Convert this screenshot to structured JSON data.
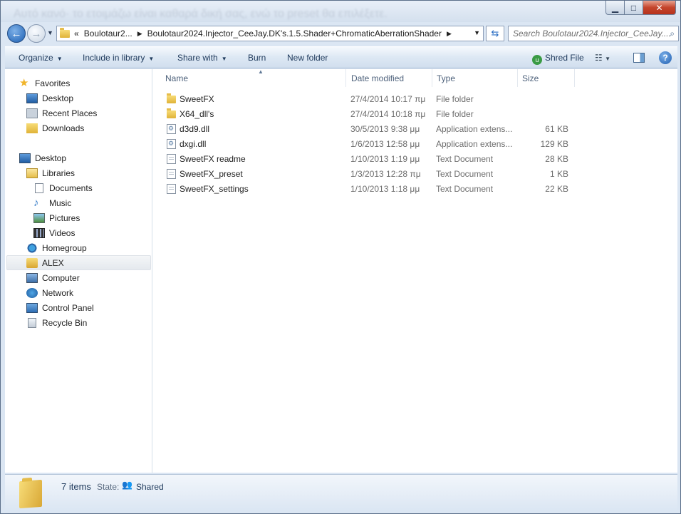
{
  "background_title": "Αυτό κανό· το ετοιμάζω είναι καθαρά δική σας, ενώ το preset θα επιλέξετε.",
  "address": {
    "overflow": "«",
    "crumbs": [
      "Boulotaur2...",
      "Boulotaur2024.Injector_CeeJay.DK's.1.5.Shader+ChromaticAberrationShader"
    ]
  },
  "search": {
    "placeholder": "Search Boulotaur2024.Injector_CeeJay...."
  },
  "toolbar": {
    "organize": "Organize",
    "include": "Include in library",
    "share": "Share with",
    "burn": "Burn",
    "new_folder": "New folder",
    "shred": "Shred File"
  },
  "nav": {
    "favorites": "Favorites",
    "desktop_fav": "Desktop",
    "recent": "Recent Places",
    "downloads": "Downloads",
    "desktop": "Desktop",
    "libraries": "Libraries",
    "documents": "Documents",
    "music": "Music",
    "pictures": "Pictures",
    "videos": "Videos",
    "homegroup": "Homegroup",
    "alex": "ALEX",
    "computer": "Computer",
    "network": "Network",
    "control_panel": "Control Panel",
    "recycle_bin": "Recycle Bin"
  },
  "columns": {
    "name": "Name",
    "date": "Date modified",
    "type": "Type",
    "size": "Size"
  },
  "files": [
    {
      "name": "SweetFX",
      "date": "27/4/2014 10:17 πμ",
      "type": "File folder",
      "size": "",
      "icon": "folder"
    },
    {
      "name": "X64_dll's",
      "date": "27/4/2014 10:18 πμ",
      "type": "File folder",
      "size": "",
      "icon": "folder"
    },
    {
      "name": "d3d9.dll",
      "date": "30/5/2013 9:38 μμ",
      "type": "Application extens...",
      "size": "61 KB",
      "icon": "dll"
    },
    {
      "name": "dxgi.dll",
      "date": "1/6/2013 12:58 μμ",
      "type": "Application extens...",
      "size": "129 KB",
      "icon": "dll"
    },
    {
      "name": "SweetFX readme",
      "date": "1/10/2013 1:19 μμ",
      "type": "Text Document",
      "size": "28 KB",
      "icon": "txt"
    },
    {
      "name": "SweetFX_preset",
      "date": "1/3/2013 12:28 πμ",
      "type": "Text Document",
      "size": "1 KB",
      "icon": "txt"
    },
    {
      "name": "SweetFX_settings",
      "date": "1/10/2013 1:18 μμ",
      "type": "Text Document",
      "size": "22 KB",
      "icon": "txt"
    }
  ],
  "details": {
    "count": "7 items",
    "state_label": "State:",
    "state_value": "Shared"
  }
}
